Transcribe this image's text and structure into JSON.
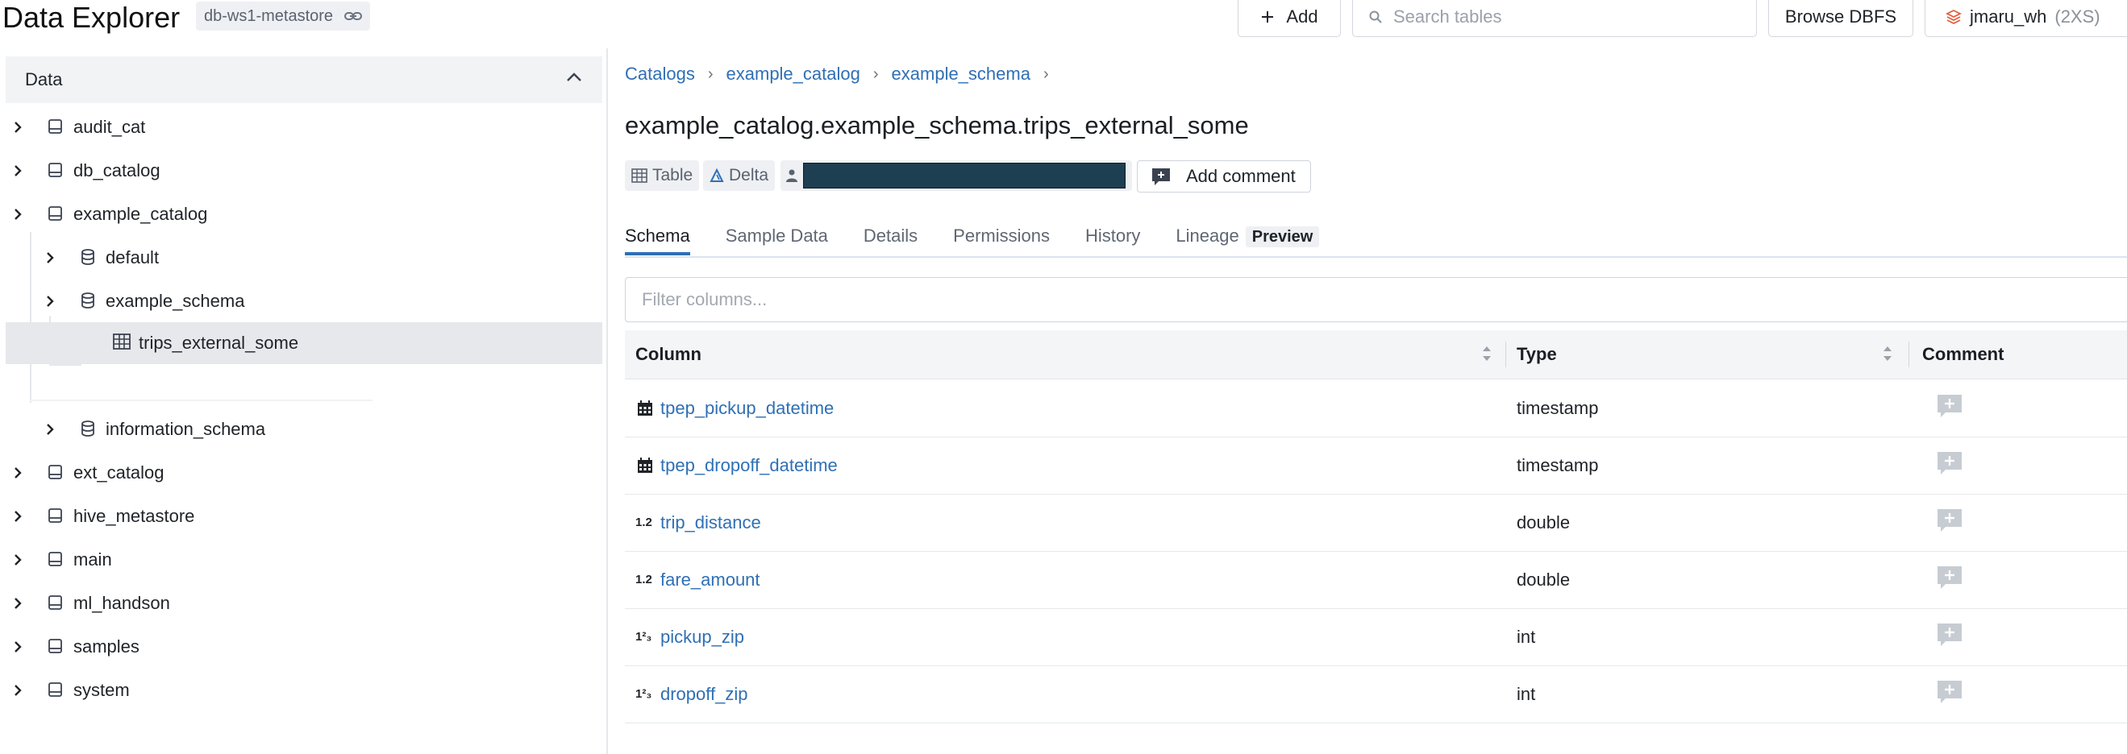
{
  "header": {
    "title": "Data Explorer",
    "workspace": "db-ws1-metastore",
    "add_label": "Add",
    "search_placeholder": "Search tables",
    "browse_label": "Browse DBFS",
    "warehouse_name": "jmaru_wh",
    "warehouse_size": "(2XS)"
  },
  "sidebar": {
    "title": "Data",
    "items": [
      {
        "label": "audit_cat"
      },
      {
        "label": "db_catalog"
      },
      {
        "label": "example_catalog"
      },
      {
        "label": "default"
      },
      {
        "label": "example_schema"
      },
      {
        "label": "trips_external_some"
      },
      {
        "label": "information_schema"
      },
      {
        "label": "ext_catalog"
      },
      {
        "label": "hive_metastore"
      },
      {
        "label": "main"
      },
      {
        "label": "ml_handson"
      },
      {
        "label": "samples"
      },
      {
        "label": "system"
      }
    ]
  },
  "main": {
    "breadcrumbs": [
      "Catalogs",
      "example_catalog",
      "example_schema"
    ],
    "table_title": "example_catalog.example_schema.trips_external_some",
    "tags": {
      "type": "Table",
      "format": "Delta"
    },
    "add_comment_label": "Add comment",
    "tabs": [
      "Schema",
      "Sample Data",
      "Details",
      "Permissions",
      "History",
      "Lineage"
    ],
    "lineage_badge": "Preview",
    "active_tab": "Schema",
    "filter_placeholder": "Filter columns...",
    "columns_header": {
      "column": "Column",
      "type": "Type",
      "comment": "Comment"
    },
    "rows": [
      {
        "name": "tpep_pickup_datetime",
        "type": "timestamp",
        "icon": "calendar-icon"
      },
      {
        "name": "tpep_dropoff_datetime",
        "type": "timestamp",
        "icon": "calendar-icon"
      },
      {
        "name": "trip_distance",
        "type": "double",
        "icon": "decimal-icon",
        "icon_text": "1.2"
      },
      {
        "name": "fare_amount",
        "type": "double",
        "icon": "decimal-icon",
        "icon_text": "1.2"
      },
      {
        "name": "pickup_zip",
        "type": "int",
        "icon": "integer-icon",
        "icon_text": "1²₃"
      },
      {
        "name": "dropoff_zip",
        "type": "int",
        "icon": "integer-icon",
        "icon_text": "1²₃"
      }
    ]
  },
  "colors": {
    "link": "#2f6fb5",
    "redaction": "#1e3e52"
  }
}
